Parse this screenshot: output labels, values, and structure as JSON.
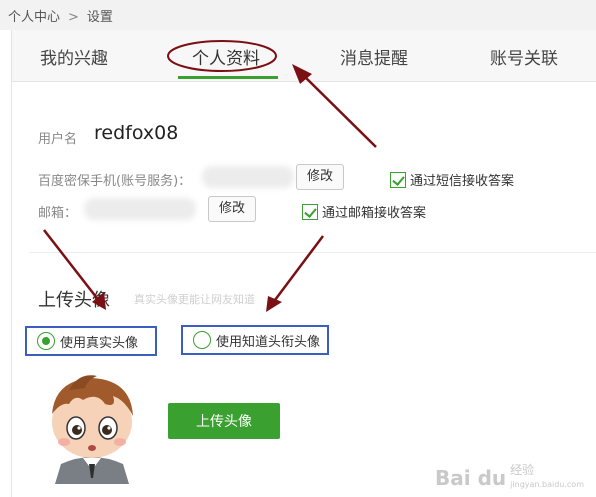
{
  "breadcrumb": {
    "home": "个人中心",
    "separator": ">",
    "current": "设置"
  },
  "tabs": [
    {
      "label": "我的兴趣"
    },
    {
      "label": "个人资料"
    },
    {
      "label": "消息提醒"
    },
    {
      "label": "账号关联"
    }
  ],
  "active_tab": "个人资料",
  "profile": {
    "username_label": "用户名",
    "username_value": "redfox08",
    "phone_label": "百度密保手机(账号服务)：",
    "phone_edit": "修改",
    "phone_check": "通过短信接收答案",
    "email_label": "邮箱：",
    "email_edit": "修改",
    "email_check": "通过邮箱接收答案"
  },
  "avatar_section": {
    "title": "上传头像",
    "hint": "真实头像更能让网友知道",
    "option_real": "使用真实头像",
    "option_rank": "使用知道头衔头像",
    "selected": "使用真实头像",
    "upload_button": "上传头像"
  },
  "watermark": {
    "brand": "Bai du",
    "sub1": "经验",
    "sub2": "jingyan.baidu.com"
  },
  "colors": {
    "accent": "#3aa02f",
    "annotation": "#7a0f14",
    "highlight_box": "#3b5fc0"
  }
}
